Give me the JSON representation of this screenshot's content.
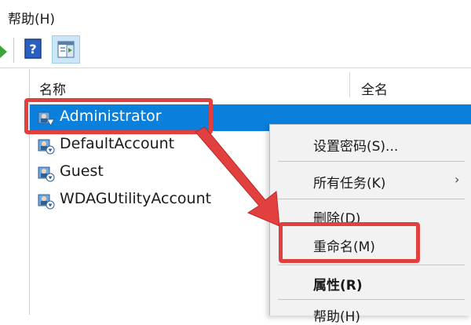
{
  "menu": {
    "help_label": "帮助(H)"
  },
  "toolbar": {
    "help_icon_glyph": "?"
  },
  "columns": {
    "name": "名称",
    "full_name": "全名"
  },
  "accounts": [
    {
      "name": "Administrator",
      "selected": true
    },
    {
      "name": "DefaultAccount",
      "selected": false
    },
    {
      "name": "Guest",
      "selected": false
    },
    {
      "name": "WDAGUtilityAccount",
      "selected": false
    }
  ],
  "context_menu": {
    "items": [
      {
        "label": "设置密码(S)..."
      },
      {
        "label": "所有任务(K)",
        "submenu_glyph": "›"
      },
      {
        "label": "删除(D)"
      },
      {
        "label": "重命名(M)"
      },
      {
        "label": "属性(R)"
      },
      {
        "label": "帮助(H)"
      }
    ]
  },
  "annotation": {
    "highlight_color": "#e2403f"
  },
  "colors": {
    "selection": "#0b7fdc",
    "menu_bg": "#f2f2f2"
  }
}
